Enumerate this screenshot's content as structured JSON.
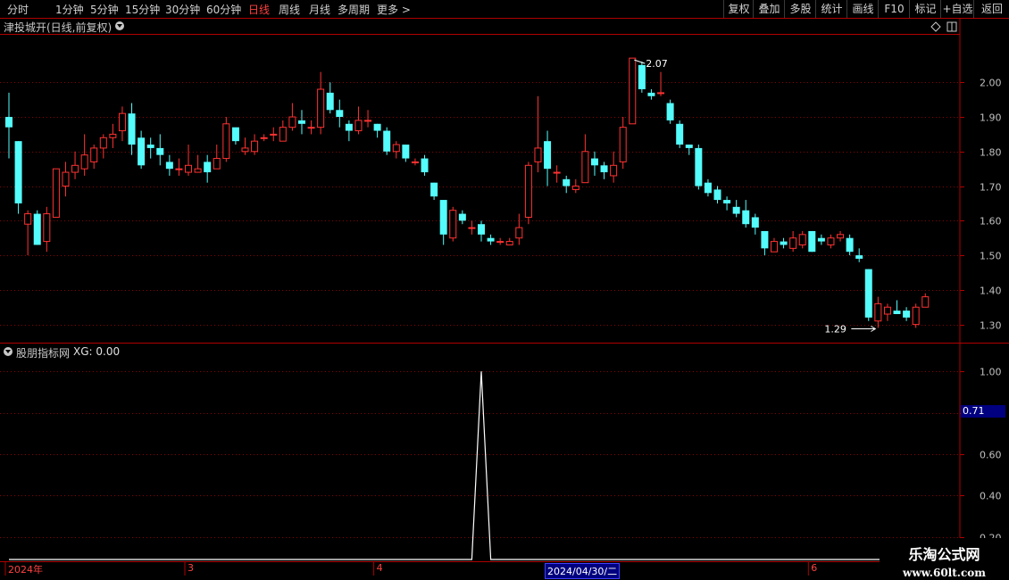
{
  "toolbar": {
    "periods": [
      "分时",
      "1分钟",
      "5分钟",
      "15分钟",
      "30分钟",
      "60分钟",
      "日线",
      "周线",
      "月线",
      "多周期",
      "更多 >"
    ],
    "active_period": "日线",
    "right_buttons": [
      "复权",
      "叠加",
      "多股",
      "统计",
      "画线",
      "F10",
      "标记",
      "+自选",
      "返回"
    ]
  },
  "main_panel": {
    "title": "津投城开(日线,前复权)",
    "high_label": "2.07",
    "low_label": "1.29"
  },
  "sub_panel": {
    "title": "股朋指标网",
    "indicator": "XG: 0.00"
  },
  "cursor": {
    "value": "0.71",
    "date": "2024/04/30/二"
  },
  "date_axis": [
    {
      "label": "2024年",
      "index": 0
    },
    {
      "label": "3",
      "index": 19
    },
    {
      "label": "4",
      "index": 39
    },
    {
      "label": "6",
      "index": 85
    }
  ],
  "watermark": {
    "title": "乐淘公式网",
    "url": "www.60lt.com"
  },
  "colors": {
    "up": "#ff3232",
    "down": "#54fcfc",
    "border": "#b00000",
    "grid": "#8b0000",
    "axis_text": "#c0c0c0",
    "line": "#ffffff"
  },
  "chart_data": [
    {
      "type": "candlestick",
      "title": "津投城开(日线,前复权)",
      "ylim": [
        1.25,
        2.14
      ],
      "yticks": [
        1.3,
        1.4,
        1.5,
        1.6,
        1.7,
        1.8,
        1.9,
        2.0
      ],
      "grid": true,
      "candles": [
        [
          1.9,
          1.87,
          1.97,
          1.78
        ],
        [
          1.83,
          1.65,
          1.83,
          1.62
        ],
        [
          1.59,
          1.62,
          1.63,
          1.5
        ],
        [
          1.62,
          1.53,
          1.63,
          1.53
        ],
        [
          1.54,
          1.62,
          1.64,
          1.51
        ],
        [
          1.61,
          1.75,
          1.75,
          1.61
        ],
        [
          1.7,
          1.74,
          1.77,
          1.67
        ],
        [
          1.74,
          1.76,
          1.8,
          1.72
        ],
        [
          1.75,
          1.79,
          1.85,
          1.73
        ],
        [
          1.77,
          1.81,
          1.82,
          1.75
        ],
        [
          1.81,
          1.84,
          1.85,
          1.78
        ],
        [
          1.84,
          1.85,
          1.88,
          1.81
        ],
        [
          1.86,
          1.91,
          1.93,
          1.83
        ],
        [
          1.91,
          1.82,
          1.94,
          1.79
        ],
        [
          1.84,
          1.76,
          1.86,
          1.75
        ],
        [
          1.82,
          1.81,
          1.84,
          1.78
        ],
        [
          1.81,
          1.79,
          1.85,
          1.76
        ],
        [
          1.77,
          1.75,
          1.79,
          1.73
        ],
        [
          1.75,
          1.75,
          1.78,
          1.73
        ],
        [
          1.74,
          1.76,
          1.82,
          1.73
        ],
        [
          1.74,
          1.75,
          1.79,
          1.74
        ],
        [
          1.77,
          1.74,
          1.79,
          1.71
        ],
        [
          1.75,
          1.78,
          1.82,
          1.75
        ],
        [
          1.78,
          1.88,
          1.9,
          1.77
        ],
        [
          1.87,
          1.83,
          1.86,
          1.82
        ],
        [
          1.8,
          1.81,
          1.84,
          1.79
        ],
        [
          1.8,
          1.83,
          1.85,
          1.79
        ],
        [
          1.84,
          1.84,
          1.85,
          1.83
        ],
        [
          1.85,
          1.85,
          1.87,
          1.83
        ],
        [
          1.83,
          1.87,
          1.89,
          1.84
        ],
        [
          1.87,
          1.9,
          1.94,
          1.86
        ],
        [
          1.89,
          1.88,
          1.92,
          1.85
        ],
        [
          1.87,
          1.87,
          1.89,
          1.85
        ],
        [
          1.87,
          1.98,
          2.03,
          1.85
        ],
        [
          1.97,
          1.92,
          2.0,
          1.91
        ],
        [
          1.92,
          1.9,
          1.95,
          1.87
        ],
        [
          1.88,
          1.86,
          1.89,
          1.83
        ],
        [
          1.86,
          1.89,
          1.93,
          1.85
        ],
        [
          1.89,
          1.89,
          1.92,
          1.87
        ],
        [
          1.88,
          1.86,
          1.88,
          1.84
        ],
        [
          1.86,
          1.8,
          1.87,
          1.79
        ],
        [
          1.8,
          1.82,
          1.83,
          1.78
        ],
        [
          1.82,
          1.78,
          1.82,
          1.77
        ],
        [
          1.77,
          1.77,
          1.78,
          1.76
        ],
        [
          1.78,
          1.74,
          1.79,
          1.73
        ],
        [
          1.71,
          1.67,
          1.71,
          1.66
        ],
        [
          1.66,
          1.56,
          1.66,
          1.53
        ],
        [
          1.55,
          1.63,
          1.64,
          1.54
        ],
        [
          1.62,
          1.6,
          1.63,
          1.59
        ],
        [
          1.58,
          1.58,
          1.6,
          1.56
        ],
        [
          1.59,
          1.56,
          1.6,
          1.54
        ],
        [
          1.55,
          1.54,
          1.56,
          1.53
        ],
        [
          1.54,
          1.54,
          1.55,
          1.53
        ],
        [
          1.53,
          1.54,
          1.55,
          1.53
        ],
        [
          1.55,
          1.58,
          1.62,
          1.53
        ],
        [
          1.61,
          1.76,
          1.77,
          1.59
        ],
        [
          1.77,
          1.81,
          1.96,
          1.74
        ],
        [
          1.83,
          1.75,
          1.86,
          1.7
        ],
        [
          1.74,
          1.74,
          1.76,
          1.71
        ],
        [
          1.72,
          1.7,
          1.73,
          1.68
        ],
        [
          1.69,
          1.7,
          1.72,
          1.68
        ],
        [
          1.71,
          1.8,
          1.85,
          1.71
        ],
        [
          1.78,
          1.76,
          1.8,
          1.73
        ],
        [
          1.76,
          1.74,
          1.77,
          1.72
        ],
        [
          1.73,
          1.76,
          1.8,
          1.71
        ],
        [
          1.77,
          1.87,
          1.9,
          1.75
        ],
        [
          1.88,
          2.07,
          2.07,
          1.88
        ],
        [
          2.05,
          1.98,
          2.06,
          1.97
        ],
        [
          1.97,
          1.96,
          1.98,
          1.95
        ],
        [
          1.97,
          1.97,
          2.03,
          1.96
        ],
        [
          1.94,
          1.89,
          1.95,
          1.88
        ],
        [
          1.88,
          1.82,
          1.89,
          1.81
        ],
        [
          1.82,
          1.81,
          1.82,
          1.79
        ],
        [
          1.81,
          1.7,
          1.82,
          1.69
        ],
        [
          1.71,
          1.68,
          1.72,
          1.67
        ],
        [
          1.69,
          1.66,
          1.7,
          1.65
        ],
        [
          1.66,
          1.65,
          1.67,
          1.63
        ],
        [
          1.64,
          1.62,
          1.66,
          1.61
        ],
        [
          1.63,
          1.59,
          1.66,
          1.58
        ],
        [
          1.61,
          1.58,
          1.62,
          1.56
        ],
        [
          1.57,
          1.52,
          1.57,
          1.5
        ],
        [
          1.51,
          1.54,
          1.55,
          1.51
        ],
        [
          1.54,
          1.53,
          1.55,
          1.52
        ],
        [
          1.52,
          1.55,
          1.57,
          1.51
        ],
        [
          1.53,
          1.56,
          1.57,
          1.52
        ],
        [
          1.57,
          1.51,
          1.57,
          1.51
        ],
        [
          1.55,
          1.54,
          1.56,
          1.53
        ],
        [
          1.53,
          1.55,
          1.56,
          1.52
        ],
        [
          1.55,
          1.56,
          1.57,
          1.54
        ],
        [
          1.55,
          1.51,
          1.56,
          1.5
        ],
        [
          1.5,
          1.49,
          1.52,
          1.48
        ],
        [
          1.46,
          1.32,
          1.46,
          1.31
        ],
        [
          1.31,
          1.36,
          1.38,
          1.29
        ],
        [
          1.33,
          1.35,
          1.36,
          1.31
        ],
        [
          1.34,
          1.33,
          1.37,
          1.33
        ],
        [
          1.34,
          1.32,
          1.35,
          1.31
        ],
        [
          1.3,
          1.35,
          1.36,
          1.29
        ],
        [
          1.35,
          1.38,
          1.39,
          1.35
        ]
      ]
    },
    {
      "type": "line",
      "title": "股朋指标网",
      "ylim": [
        0.1,
        1.07
      ],
      "yticks": [
        0.2,
        0.4,
        0.6,
        0.8,
        1.0
      ],
      "series": [
        {
          "name": "XG",
          "values": [
            0,
            0,
            0,
            0,
            0,
            0,
            0,
            0,
            0,
            0,
            0,
            0,
            0,
            0,
            0,
            0,
            0,
            0,
            0,
            0,
            0,
            0,
            0,
            0,
            0,
            0,
            0,
            0,
            0,
            0,
            0,
            0,
            0,
            0,
            0,
            0,
            0,
            0,
            0,
            0,
            0,
            0,
            0,
            0,
            0,
            0,
            0,
            0,
            0,
            0,
            0,
            0,
            0,
            0,
            0,
            0,
            0,
            0,
            0,
            0,
            0,
            0,
            0,
            0,
            0,
            0,
            0,
            0,
            0,
            0,
            0,
            0,
            0,
            0,
            0,
            0,
            0,
            0,
            0,
            0,
            0,
            0,
            0,
            0,
            0,
            0,
            0,
            0,
            0,
            0,
            0,
            0,
            0,
            0,
            0,
            0,
            0,
            0,
            0
          ]
        }
      ],
      "spike": {
        "index": 50,
        "value": 1.0
      }
    }
  ]
}
